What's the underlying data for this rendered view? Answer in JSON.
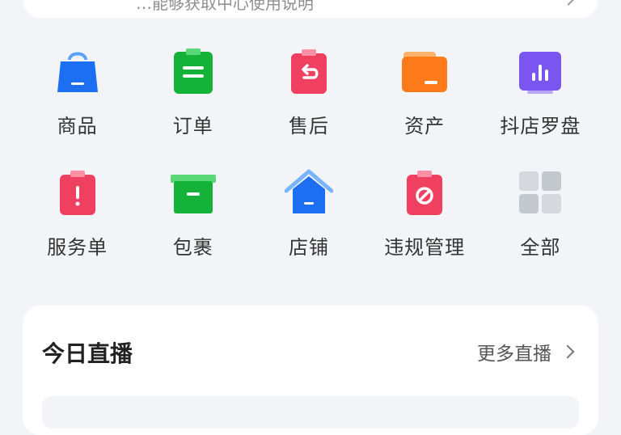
{
  "top_bar": {
    "partial_text": "…能够获取中心使用说明"
  },
  "grid": {
    "items": [
      {
        "label": "商品",
        "icon": "shopping-bag-icon"
      },
      {
        "label": "订单",
        "icon": "order-clipboard-icon"
      },
      {
        "label": "售后",
        "icon": "after-sales-return-icon"
      },
      {
        "label": "资产",
        "icon": "folder-wallet-icon"
      },
      {
        "label": "抖店罗盘",
        "icon": "bar-chart-icon"
      },
      {
        "label": "服务单",
        "icon": "alert-clipboard-icon"
      },
      {
        "label": "包裹",
        "icon": "package-box-icon"
      },
      {
        "label": "店铺",
        "icon": "store-house-icon"
      },
      {
        "label": "违规管理",
        "icon": "prohibited-icon"
      },
      {
        "label": "全部",
        "icon": "grid-all-icon"
      }
    ]
  },
  "live": {
    "title": "今日直播",
    "more_label": "更多直播"
  },
  "colors": {
    "blue": "#1d6ff2",
    "green": "#15b23a",
    "pink": "#f0405f",
    "orange": "#ff7a1a",
    "purple": "#7a55f0",
    "gray": "#cfd2d8"
  }
}
